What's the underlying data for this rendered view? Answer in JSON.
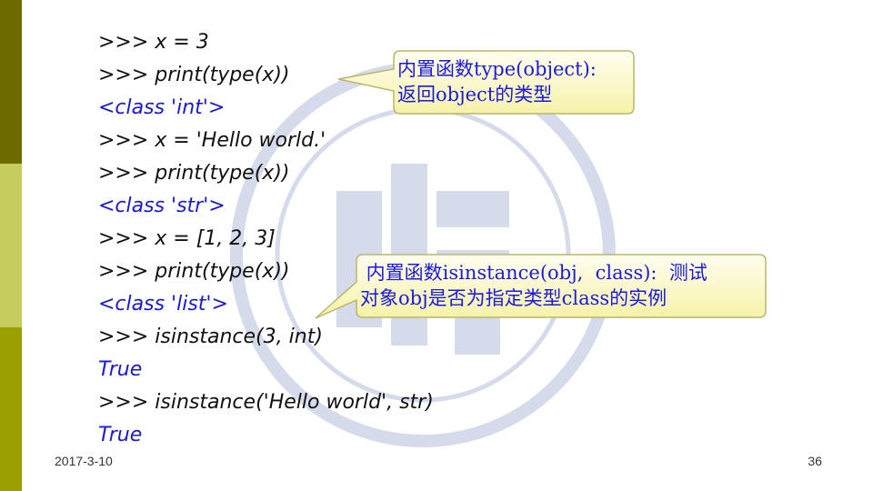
{
  "slide": {
    "code_lines": [
      {
        "text": ">>> x = 3",
        "kind": "input"
      },
      {
        "text": ">>> print(type(x))",
        "kind": "input"
      },
      {
        "text": "<class 'int'>",
        "kind": "output"
      },
      {
        "text": ">>> x = 'Hello world.'",
        "kind": "input"
      },
      {
        "text": ">>> print(type(x))",
        "kind": "input"
      },
      {
        "text": "<class 'str'>",
        "kind": "output"
      },
      {
        "text": ">>> x = [1, 2, 3]",
        "kind": "input"
      },
      {
        "text": ">>> print(type(x))",
        "kind": "input"
      },
      {
        "text": "<class 'list'>",
        "kind": "output"
      },
      {
        "text": ">>> isinstance(3, int)",
        "kind": "input"
      },
      {
        "text": "True",
        "kind": "output"
      },
      {
        "text": ">>> isinstance('Hello world', str)",
        "kind": "input"
      },
      {
        "text": "True",
        "kind": "output"
      }
    ],
    "callouts": [
      {
        "lines": [
          "内置函数type(object):",
          "返回object的类型"
        ]
      },
      {
        "lines": [
          " 内置函数isinstance(obj,  class):  测试",
          "对象obj是否为指定类型class的实例"
        ]
      }
    ],
    "footer": {
      "date": "2017-3-10",
      "page": "36"
    },
    "colors": {
      "input_text": "#111111",
      "output_text": "#1a1ad6",
      "callout_fill": "#fdfbc8",
      "callout_border": "#b8b86a",
      "bar_top": "#6b6b00",
      "bar_middle": "#c6cd5e",
      "bar_bottom": "#9ba000"
    }
  }
}
